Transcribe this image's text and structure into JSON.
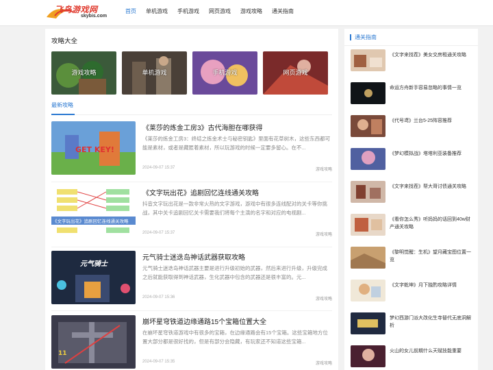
{
  "header": {
    "logo_text": "飞鸟游戏网",
    "logo_sub": "skybis.com",
    "nav": [
      "首页",
      "单机游戏",
      "手机游戏",
      "网页游戏",
      "游戏攻略",
      "通关指南"
    ]
  },
  "main": {
    "section_title": "攻略大全",
    "categories": [
      "游戏攻略",
      "单机游戏",
      "手机游戏",
      "网页游戏"
    ],
    "tab_label": "最新攻略",
    "articles": [
      {
        "title": "《莱莎的炼金工房3》古代海胆在哪获得",
        "desc": "《莱莎的炼金工房3：终结之炼金术士与秘密钥匙》里面有花草树木，这些东西都可能是素材，或者是藏匿着素材，所以玩游戏的时候一定要多留心。在不...",
        "date": "2024-09-07 15:37",
        "tag": "游戏攻略",
        "thumb_text": "GET KEY!"
      },
      {
        "title": "《文字玩出花》追剧回忆连线通关攻略",
        "desc": "抖音文字玩出花是一款非常火热的文字游戏，游戏中有很多连线配对的关卡等你挑战，其中关卡追剧回忆关卡需要我们将每个主演的名字和对应的电视剧...",
        "date": "2024-09-07 15:37",
        "tag": "游戏攻略",
        "thumb_text": "《文字玩出花》追剧回忆连线通关攻略"
      },
      {
        "title": "元气骑士迷迭岛神话武器获取攻略",
        "desc": "元气骑士迷迭岛神话武器主要是进行升级初始的武器，然后来进行升级，升级完成之后就能获取得到神话武器，生化武器中包含的武器还是很丰富的。元...",
        "date": "2024-09-07 15:36",
        "tag": "游戏攻略",
        "thumb_text": "元气骑士"
      },
      {
        "title": "崩坏星穹铁道边缘通路15个宝箱位置大全",
        "desc": "在崩坏星穹铁道游戏中有很多的宝箱，在边缘通路会有15个宝箱。这些宝箱地方位置大部分都是很好找的，但是有部分会隐藏，有玩家还不知道这些宝箱...",
        "date": "2024-09-07 15:35",
        "tag": "游戏攻略",
        "thumb_text": "11"
      }
    ]
  },
  "sidebar": {
    "title": "通关指南",
    "items": [
      "《文字来找茬》美女交房租通关攻略",
      "命运方舟新手容易忽略的事情一览",
      "《代号鸢》兰台5-25阵容推荐",
      "《梦幻模拟战》塔塔利亚装备推荐",
      "《文字来找茬》帮大哥讨债通关攻略",
      "《看你怎么秀》听妈妈的话回到40w财产通关攻略",
      "《黎明觉醒：生机》望月藏宝图位置一览",
      "《文字乾坤》月下独酌攻略详情",
      "梦幻西游门派大改化生寺替代无底洞解析",
      "火山的女儿前期什么天赋技能重要"
    ]
  },
  "colors": {
    "accent": "#2a78d1",
    "logo_red": "#e03a2e"
  }
}
